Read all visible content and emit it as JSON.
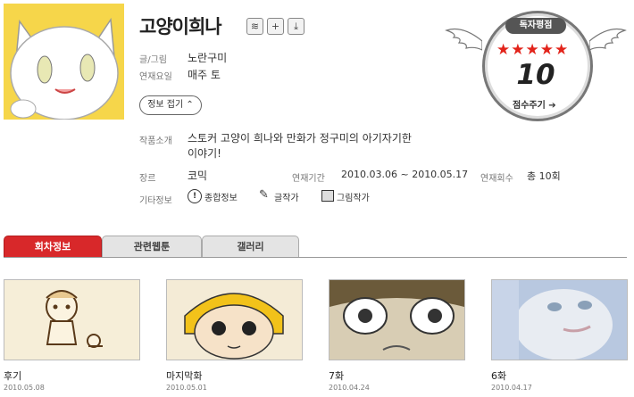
{
  "header": {
    "title": "고양이희나",
    "icons": [
      "rss-icon",
      "plus-icon",
      "download-icon"
    ]
  },
  "info": {
    "author_label": "글/그림",
    "author_value": "노란구미",
    "day_label": "연재요일",
    "day_value": "매주 토",
    "fold_button": "정보 접기",
    "intro_label": "작품소개",
    "intro_line1": "스토커 고양이 희나와 만화가 정구미의 아기자기한",
    "intro_line2": "이야기!",
    "genre_label": "장르",
    "genre_value": "코믹",
    "period_label": "연재기간",
    "period_value": "2010.03.06 ~ 2010.05.17",
    "count_label": "연재회수",
    "count_value": "총 10회",
    "etc_label": "기타정보",
    "etc_links": [
      "종합정보",
      "글작가",
      "그림작가"
    ]
  },
  "rating": {
    "title": "독자평점",
    "stars": "★★★★★",
    "score": "10",
    "rate_button": "점수주기 ➔",
    "star_color": "#e2231a"
  },
  "tabs": [
    {
      "label": "회차정보",
      "active": true
    },
    {
      "label": "관련웹툰",
      "active": false
    },
    {
      "label": "갤러리",
      "active": false
    }
  ],
  "episodes": [
    {
      "title": "후기",
      "date": "2010.05.08"
    },
    {
      "title": "마지막화",
      "date": "2010.05.01"
    },
    {
      "title": "7화",
      "date": "2010.04.24"
    },
    {
      "title": "6화",
      "date": "2010.04.17"
    }
  ],
  "colors": {
    "accent": "#d8282a"
  }
}
